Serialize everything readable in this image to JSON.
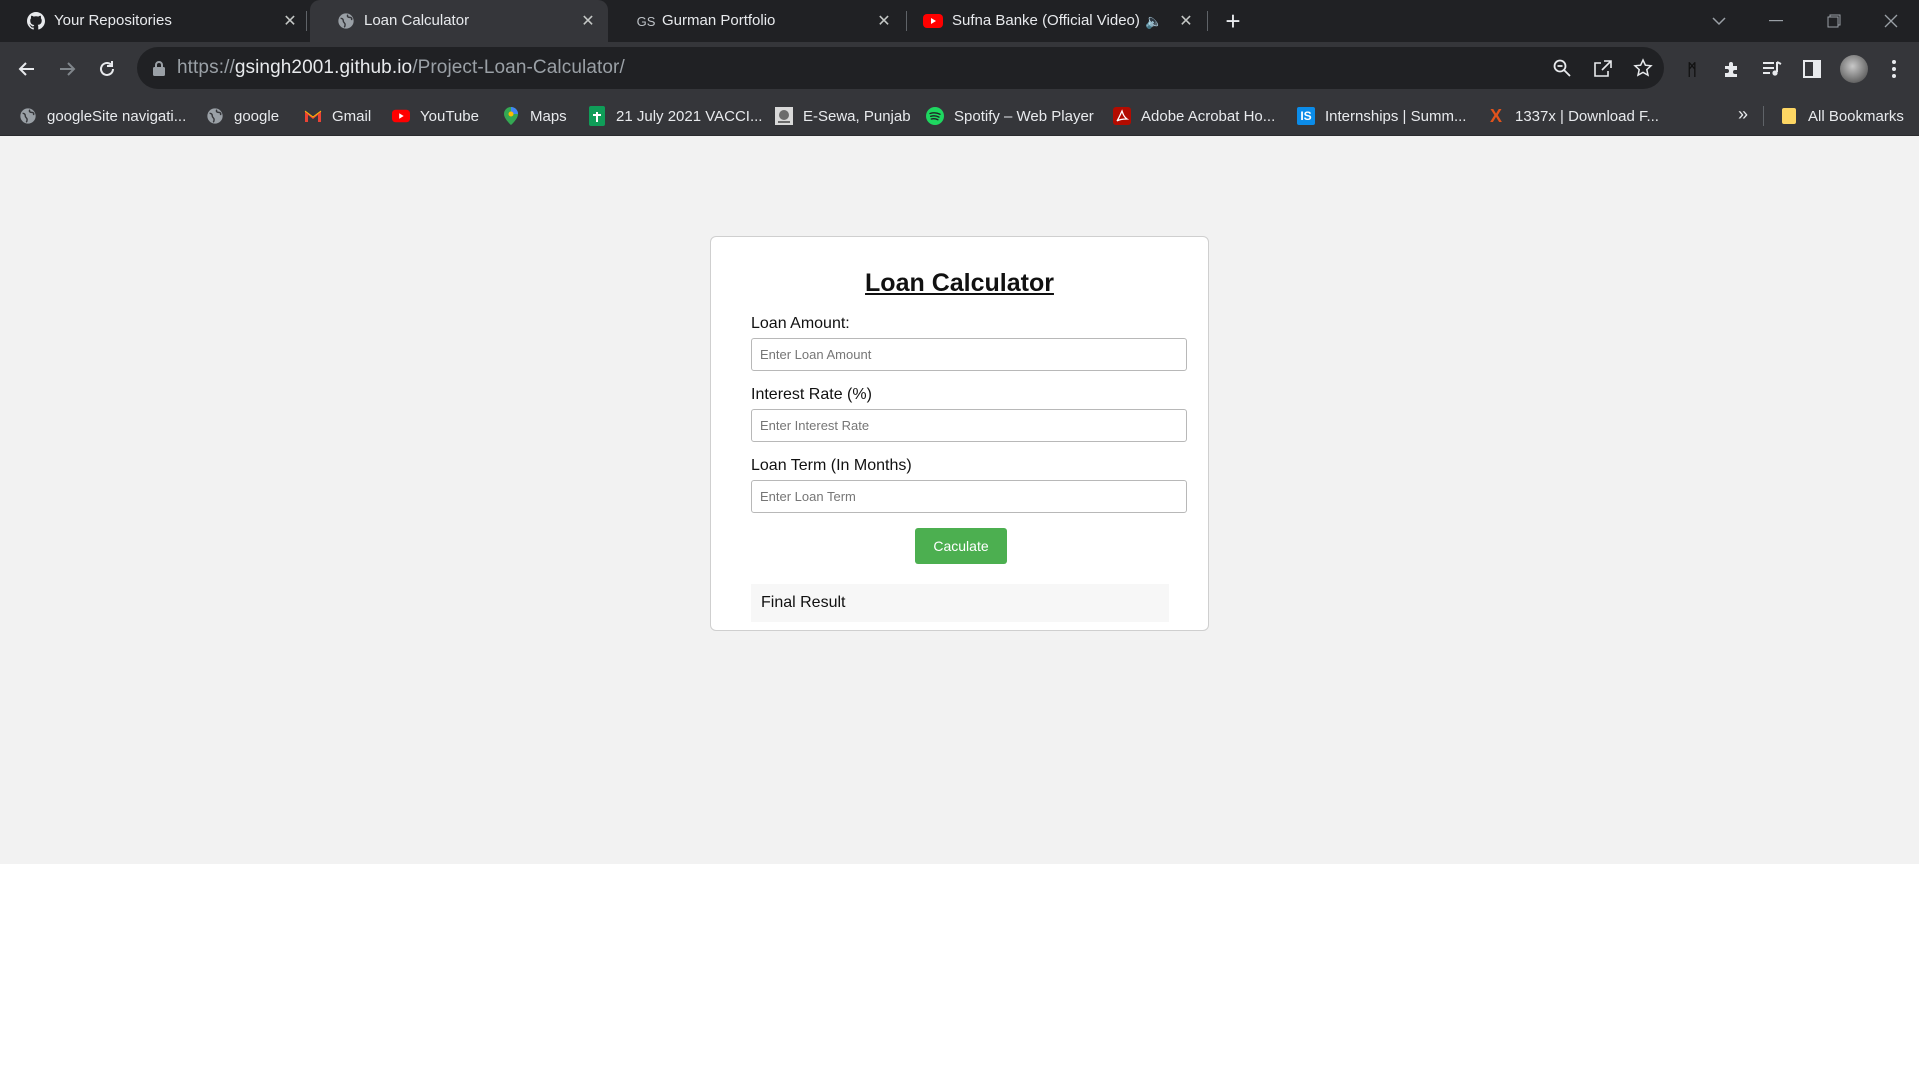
{
  "browser": {
    "tabs": [
      {
        "title": "Your Repositories",
        "icon": "github-icon"
      },
      {
        "title": "Loan Calculator",
        "icon": "globe-icon"
      },
      {
        "title": "Gurman Portfolio",
        "icon": "gs-icon",
        "icon_text": "GS"
      },
      {
        "title": "Sufna Banke (Official Video)",
        "icon": "youtube-icon"
      }
    ],
    "url_scheme": "https://",
    "url_host": "gsingh2001.github.io",
    "url_path": "/Project-Loan-Calculator/",
    "bookmarks": [
      {
        "label": "googleSite navigati...",
        "icon": "globe-icon"
      },
      {
        "label": "google",
        "icon": "globe-icon"
      },
      {
        "label": "Gmail",
        "icon": "gmail-icon"
      },
      {
        "label": "YouTube",
        "icon": "youtube-icon"
      },
      {
        "label": "Maps",
        "icon": "maps-icon"
      },
      {
        "label": "21 July 2021 VACCI...",
        "icon": "sheets-icon"
      },
      {
        "label": "E-Sewa, Punjab",
        "icon": "esewa-icon"
      },
      {
        "label": "Spotify – Web Player",
        "icon": "spotify-icon"
      },
      {
        "label": "Adobe Acrobat Ho...",
        "icon": "acrobat-icon"
      },
      {
        "label": "Internships | Summ...",
        "icon": "internshala-icon",
        "icon_text": "IS"
      },
      {
        "label": "1337x | Download F...",
        "icon": "1337x-icon",
        "icon_text": "X"
      }
    ],
    "more_bookmarks_glyph": "»",
    "all_bookmarks": "All Bookmarks"
  },
  "calculator": {
    "title": "Loan Calculator",
    "loan_amount_label": "Loan Amount:",
    "loan_amount_placeholder": "Enter Loan Amount",
    "interest_rate_label": "Interest Rate (%)",
    "interest_rate_placeholder": "Enter Interest Rate",
    "loan_term_label": "Loan Term (In Months)",
    "loan_term_placeholder": "Enter Loan Term",
    "button_label": "Caculate",
    "result_text": "Final Result"
  },
  "colors": {
    "button": "#4caf50",
    "page_background": "#f2f2f2",
    "tab_strip": "#202124",
    "toolbar": "#35363a"
  }
}
